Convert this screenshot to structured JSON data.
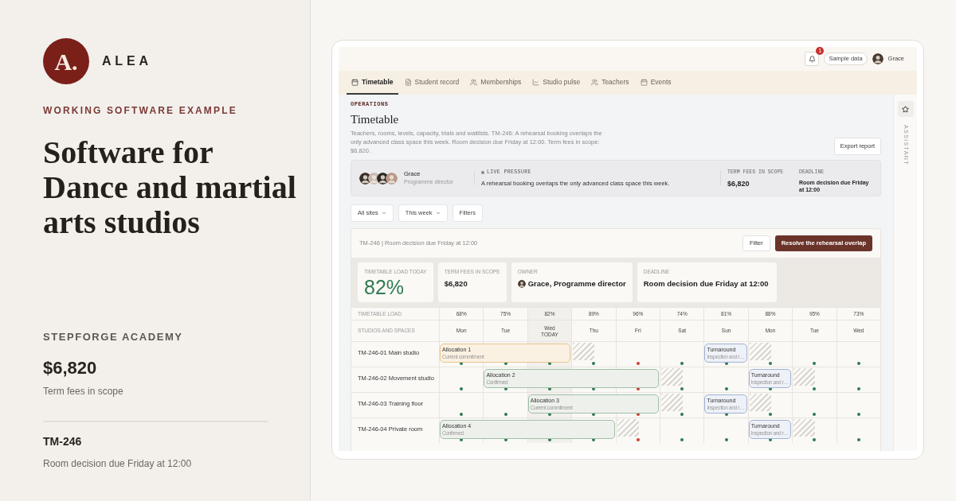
{
  "brand": {
    "logo_letter": "A.",
    "name": "ALEA"
  },
  "eyebrow": "WORKING SOFTWARE EXAMPLE",
  "headline": "Software for\nDance and martial\narts studios",
  "summary": {
    "org": "STEPFORGE ACADEMY",
    "amount": "$6,820",
    "amount_label": "Term fees in scope",
    "case_id": "TM-246",
    "case_text": "Room decision due Friday at 12:00"
  },
  "app": {
    "topbar": {
      "notifications": "1",
      "sample": "Sample data",
      "user": "Grace"
    },
    "tabs": [
      {
        "label": "Timetable",
        "selected": true
      },
      {
        "label": "Student record",
        "selected": false
      },
      {
        "label": "Memberships",
        "selected": false
      },
      {
        "label": "Studio pulse",
        "selected": false
      },
      {
        "label": "Teachers",
        "selected": false
      },
      {
        "label": "Events",
        "selected": false
      }
    ],
    "page": {
      "eyebrow": "OPERATIONS",
      "title": "Timetable",
      "description": "Teachers, rooms, levels, capacity, trials and waitlists. TM-246: A rehearsal booking overlaps the only advanced class space this week. Room decision due Friday at 12:00. Term fees in scope: $6,820.",
      "export": "Export report"
    },
    "pressure": {
      "name": "Grace",
      "role": "Programme director",
      "live_label": "LIVE PRESSURE",
      "live_text": "A rehearsal booking overlaps the only advanced class space this week.",
      "fees_label": "TERM FEES IN SCOPE",
      "fees": "$6,820",
      "deadline_label": "DEADLINE",
      "deadline": "Room decision due Friday at 12:00"
    },
    "filters": [
      {
        "label": "All sites",
        "dropdown": true
      },
      {
        "label": "This week",
        "dropdown": true
      },
      {
        "label": "Filters",
        "dropdown": false
      }
    ],
    "panel": {
      "title": "TM-246 | Room decision due Friday at 12:00",
      "filter": "Filter",
      "action": "Resolve the rehearsal overlap",
      "stats": [
        {
          "label": "TIMETABLE LOAD TODAY",
          "value": "82%",
          "kind": "highlight"
        },
        {
          "label": "TERM FEES IN SCOPE",
          "value": "$6,820",
          "kind": "plain"
        },
        {
          "label": "OWNER",
          "value": "Grace, Programme director",
          "kind": "person"
        },
        {
          "label": "DEADLINE",
          "value": "Room decision due Friday at 12:00",
          "kind": "plain"
        }
      ],
      "load_label": "TIMETABLE LOAD",
      "spaces_label": "STUDIOS AND SPACES",
      "today_label": "TODAY",
      "days": [
        {
          "load": "68%",
          "day": "Mon",
          "selected": false
        },
        {
          "load": "75%",
          "day": "Tue",
          "selected": false
        },
        {
          "load": "82%",
          "day": "Wed",
          "selected": true
        },
        {
          "load": "89%",
          "day": "Thu",
          "selected": false
        },
        {
          "load": "96%",
          "day": "Fri",
          "selected": false
        },
        {
          "load": "74%",
          "day": "Sat",
          "selected": false
        },
        {
          "load": "81%",
          "day": "Sun",
          "selected": false
        },
        {
          "load": "88%",
          "day": "Mon",
          "selected": false
        },
        {
          "load": "95%",
          "day": "Tue",
          "selected": false
        },
        {
          "load": "73%",
          "day": "Wed",
          "selected": false
        }
      ],
      "rows": [
        {
          "name": "TM-246-01 Main studio",
          "cells": [
            {
              "kind": "booking",
              "booking": {
                "title": "Allocation 1",
                "subtitle": "Current commitment",
                "kind": "current"
              },
              "color": "#2f7a4f"
            },
            {
              "kind": "continued",
              "color": "#2f7a4f"
            },
            {
              "kind": "continued",
              "color": "#2f7a4f"
            },
            {
              "kind": "blocked",
              "color": "#2f7a4f"
            },
            {
              "kind": "open",
              "color": "#c8402f"
            },
            {
              "kind": "open",
              "color": "#2f7a4f"
            },
            {
              "kind": "booking",
              "booking": {
                "title": "Turnaround",
                "subtitle": "Inspection and r…",
                "kind": "turnaround"
              },
              "color": "#2f7a4f"
            },
            {
              "kind": "blocked",
              "color": "#2f7a4f"
            },
            {
              "kind": "open",
              "color": "#2f7a4f"
            },
            {
              "kind": "open",
              "color": "#2f7a4f"
            }
          ]
        },
        {
          "name": "TM-246-02 Movement studio",
          "cells": [
            {
              "kind": "open",
              "color": "#2f7a4f"
            },
            {
              "kind": "booking",
              "booking": {
                "title": "Allocation 2",
                "subtitle": "Confirmed",
                "kind": "confirmed"
              },
              "color": "#2f7a4f"
            },
            {
              "kind": "continued",
              "color": "#2f7a4f"
            },
            {
              "kind": "continued",
              "color": "#2f7a4f"
            },
            {
              "kind": "continued",
              "color": "#c8402f"
            },
            {
              "kind": "blocked",
              "color": "#2f7a4f"
            },
            {
              "kind": "open",
              "color": "#2f7a4f"
            },
            {
              "kind": "booking",
              "booking": {
                "title": "Turnaround",
                "subtitle": "Inspection and r…",
                "kind": "turnaround"
              },
              "color": "#2f7a4f"
            },
            {
              "kind": "blocked",
              "color": "#2f7a4f"
            },
            {
              "kind": "open",
              "color": "#2f7a4f"
            }
          ]
        },
        {
          "name": "TM-246-03 Training floor",
          "cells": [
            {
              "kind": "open",
              "color": "#2f7a4f"
            },
            {
              "kind": "open",
              "color": "#2f7a4f"
            },
            {
              "kind": "booking",
              "booking": {
                "title": "Allocation 3",
                "subtitle": "Current commitment",
                "kind": "confirmed"
              },
              "color": "#2f7a4f"
            },
            {
              "kind": "continued",
              "color": "#2f7a4f"
            },
            {
              "kind": "continued",
              "color": "#c8402f"
            },
            {
              "kind": "blocked",
              "color": "#2f7a4f"
            },
            {
              "kind": "booking",
              "booking": {
                "title": "Turnaround",
                "subtitle": "Inspection and r…",
                "kind": "turnaround"
              },
              "color": "#2f7a4f"
            },
            {
              "kind": "blocked",
              "color": "#2f7a4f"
            },
            {
              "kind": "open",
              "color": "#2f7a4f"
            },
            {
              "kind": "open",
              "color": "#2f7a4f"
            }
          ]
        },
        {
          "name": "TM-246-04 Private room",
          "cells": [
            {
              "kind": "booking",
              "booking": {
                "title": "Allocation 4",
                "subtitle": "Confirmed",
                "kind": "confirmed"
              },
              "color": "#2f7a4f"
            },
            {
              "kind": "continued",
              "color": "#2f7a4f"
            },
            {
              "kind": "continued",
              "color": "#2f7a4f"
            },
            {
              "kind": "continued",
              "color": "#2f7a4f"
            },
            {
              "kind": "blocked",
              "color": "#c8402f"
            },
            {
              "kind": "open",
              "color": "#2f7a4f"
            },
            {
              "kind": "open",
              "color": "#2f7a4f"
            },
            {
              "kind": "booking",
              "booking": {
                "title": "Turnaround",
                "subtitle": "Inspection and r…",
                "kind": "turnaround"
              },
              "color": "#2f7a4f"
            },
            {
              "kind": "blocked",
              "color": "#2f7a4f"
            },
            {
              "kind": "open",
              "color": "#2f7a4f"
            }
          ]
        }
      ]
    },
    "assistant": {
      "label": "ASSISTANT"
    }
  }
}
